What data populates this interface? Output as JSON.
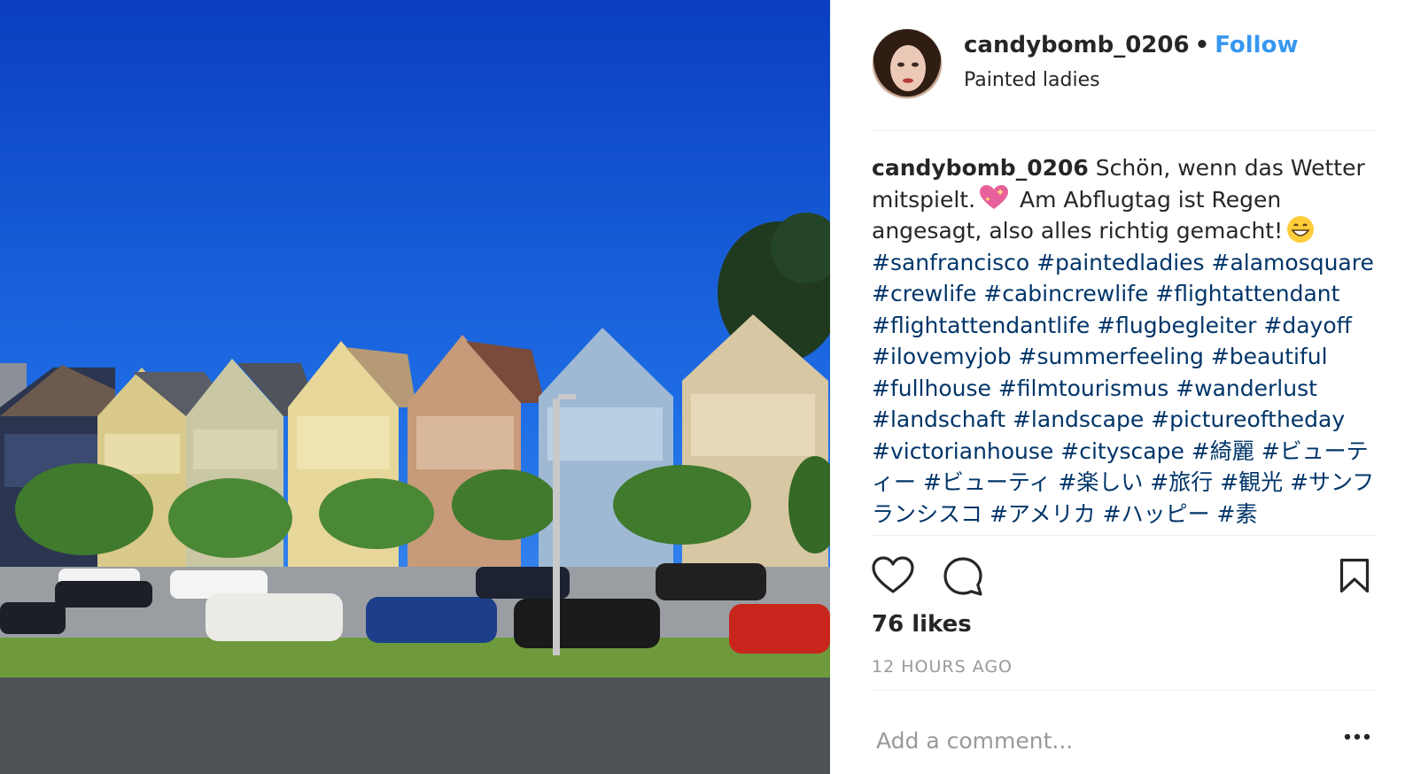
{
  "post": {
    "username": "candybomb_0206",
    "separator": "•",
    "follow_label": "Follow",
    "location": "Painted ladies",
    "caption": {
      "user": "candybomb_0206",
      "text_1": "Schön, wenn das Wetter mitspielt.",
      "text_2": "Am Abflugtag ist Regen angesagt, also alles richtig gemacht!",
      "hashtags": [
        "#sanfrancisco",
        "#paintedladies",
        "#alamosquare",
        "#crewlife",
        "#cabincrewlife",
        "#flightattendant",
        "#flightattendantlife",
        "#flugbegleiter",
        "#dayoff",
        "#ilovemyjob",
        "#summerfeeling",
        "#beautiful",
        "#fullhouse",
        "#filmtourismus",
        "#wanderlust",
        "#landschaft",
        "#landscape",
        "#pictureoftheday",
        "#victorianhouse",
        "#cityscape",
        "#綺麗",
        "#ビューティー",
        "#ビューティ",
        "#楽しい",
        "#旅行",
        "#観光",
        "#サンフランシスコ",
        "#アメリカ",
        "#ハッピー",
        "#素"
      ]
    },
    "likes": "76 likes",
    "timestamp": "12 HOURS AGO",
    "comment_placeholder": "Add a comment..."
  },
  "icons": {
    "like": "heart-icon",
    "comment": "comment-bubble-icon",
    "save": "bookmark-icon",
    "more": "more-options-icon"
  },
  "colors": {
    "follow": "#3897f0",
    "hashtag": "#003569",
    "muted": "#999999",
    "text": "#262626"
  }
}
